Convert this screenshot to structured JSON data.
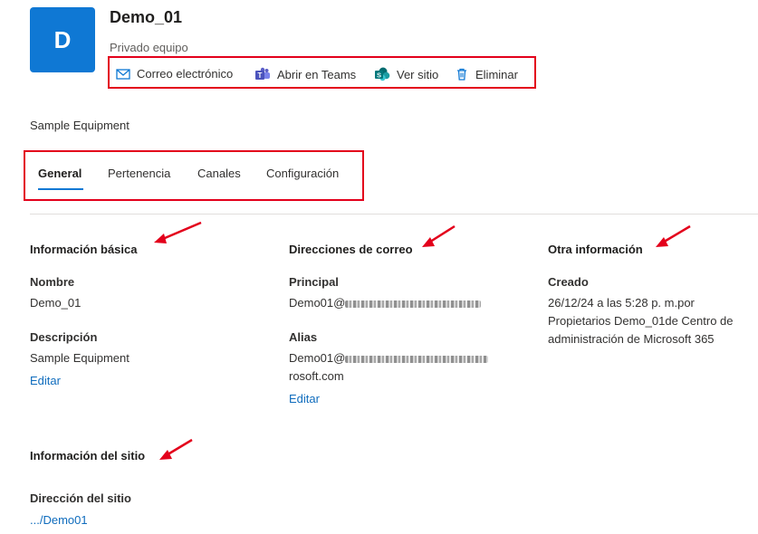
{
  "header": {
    "avatar_letter": "D",
    "title": "Demo_01",
    "subtitle": "Privado equipo"
  },
  "actions": [
    {
      "label": "Correo electrónico",
      "icon": "mail-icon"
    },
    {
      "label": "Abrir en Teams",
      "icon": "teams-icon"
    },
    {
      "label": "Ver sitio",
      "icon": "sharepoint-icon"
    },
    {
      "label": "Eliminar",
      "icon": "trash-icon"
    }
  ],
  "description": "Sample Equipment",
  "tabs": [
    {
      "label": "General",
      "active": true
    },
    {
      "label": "Pertenencia",
      "active": false
    },
    {
      "label": "Canales",
      "active": false
    },
    {
      "label": "Configuración",
      "active": false
    }
  ],
  "basic_info": {
    "title": "Información básica",
    "name_label": "Nombre",
    "name_value": "Demo_01",
    "desc_label": "Descripción",
    "desc_value": "Sample Equipment",
    "edit": "Editar"
  },
  "email": {
    "title": "Direcciones de correo",
    "primary_label": "Principal",
    "primary_prefix": "Demo01@",
    "alias_label": "Alias",
    "alias_prefix": "Demo01@",
    "alias_suffix": "rosoft.com",
    "edit": "Editar"
  },
  "other": {
    "title": "Otra información",
    "created_label": "Creado",
    "created_value": "26/12/24 a las 5:28 p. m.por Propietarios Demo_01de Centro de administración de Microsoft 365"
  },
  "site": {
    "title": "Información del sitio",
    "address_label": "Dirección del sitio",
    "address_value": ".../Demo01"
  },
  "colors": {
    "accent": "#0f78d4",
    "link": "#0f6cbd",
    "annotation": "#e3001b"
  }
}
